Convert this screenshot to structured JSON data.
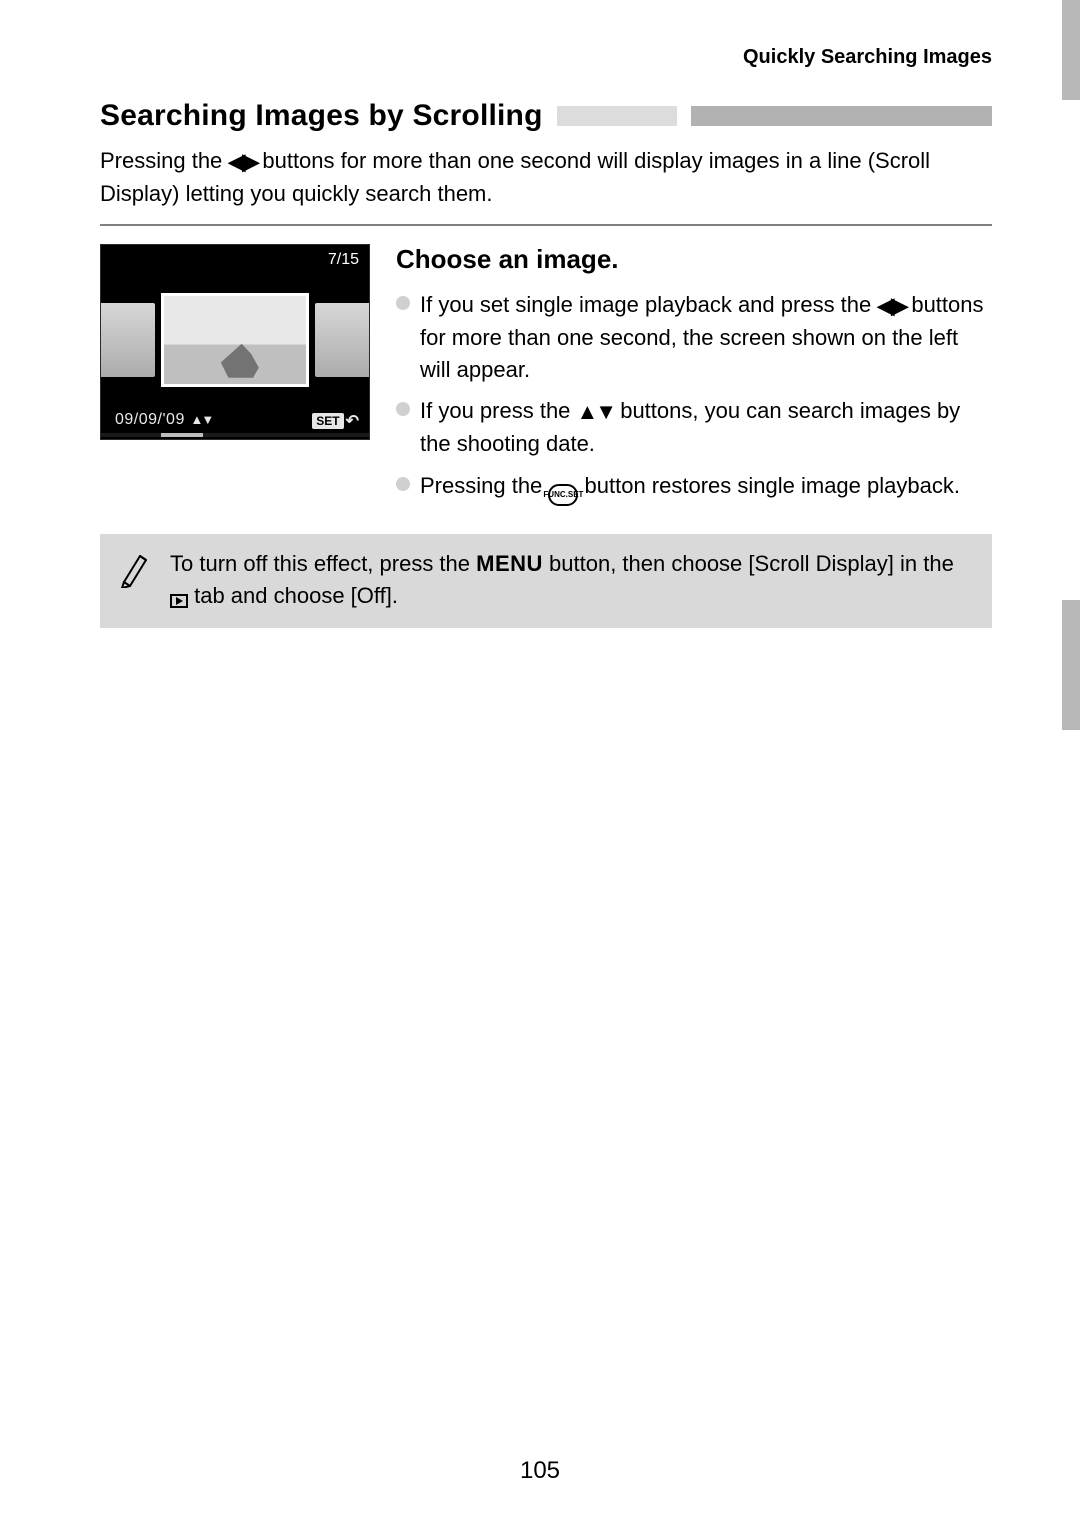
{
  "running_head": "Quickly Searching Images",
  "section_title": "Searching Images by Scrolling",
  "intro_parts": {
    "p1": "Pressing the ",
    "p2": " buttons for more than one second will display images in a line (Scroll Display) letting you quickly search them."
  },
  "lcd": {
    "count": "7/15",
    "date": "09/09/'09",
    "set_label": "SET"
  },
  "step": {
    "title": "Choose an image.",
    "bullet1": {
      "a": "If you set single image playback and press the ",
      "b": " buttons for more than one second, the screen shown on the left will appear."
    },
    "bullet2": {
      "a": "If you press the ",
      "b": " buttons, you can search images by the shooting date."
    },
    "bullet3": {
      "a": "Pressing the ",
      "b": " button restores single image playback."
    }
  },
  "icons": {
    "left_right": "◀▶",
    "up_down": "▲▼",
    "func_top": "FUNC.",
    "func_bottom": "SET",
    "menu": "MENU"
  },
  "note": {
    "a": "To turn off this effect, press the ",
    "b": " button, then choose [Scroll Display] in the ",
    "c": " tab and choose [Off]."
  },
  "page_number": "105"
}
